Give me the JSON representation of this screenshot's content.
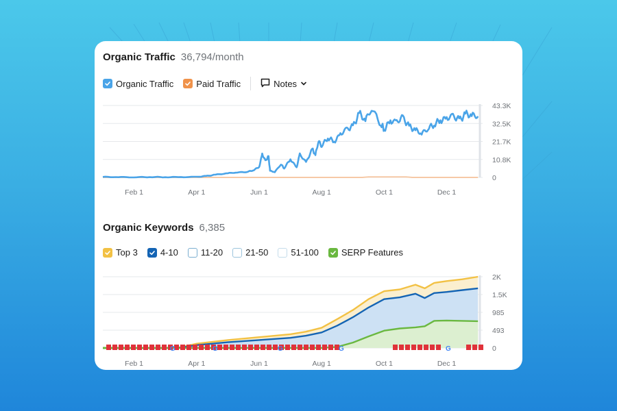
{
  "colors": {
    "organic": "#4aa4e8",
    "paid": "#f0924a",
    "top3": "#f2c144",
    "r4_10": "#1464b4",
    "serp": "#6ab840",
    "flag": "#e0323a",
    "grid": "#e6e8eb",
    "unchecked_border": "#8fb6cf"
  },
  "traffic": {
    "title": "Organic Traffic",
    "value": "36,794/month",
    "legend": [
      {
        "label": "Organic Traffic",
        "checked": true,
        "color": "#4aa4e8"
      },
      {
        "label": "Paid Traffic",
        "checked": true,
        "color": "#f0924a"
      }
    ],
    "notes_label": "Notes",
    "notes_icon": "comment-icon",
    "notes_chevron": "chevron-down-icon"
  },
  "keywords": {
    "title": "Organic Keywords",
    "value": "6,385",
    "legend": [
      {
        "label": "Top 3",
        "checked": true,
        "color": "#f2c144"
      },
      {
        "label": "4-10",
        "checked": true,
        "color": "#1464b4"
      },
      {
        "label": "11-20",
        "checked": false,
        "color": "#7aaed0"
      },
      {
        "label": "21-50",
        "checked": false,
        "color": "#9cc4dd"
      },
      {
        "label": "51-100",
        "checked": false,
        "color": "#c4dcea"
      },
      {
        "label": "SERP Features",
        "checked": true,
        "color": "#6ab840"
      }
    ]
  },
  "chart_data": [
    {
      "type": "line",
      "title": "Organic Traffic",
      "x_ticks": [
        "Feb 1",
        "Apr 1",
        "Jun 1",
        "Aug 1",
        "Oct 1",
        "Dec 1"
      ],
      "y_ticks": [
        "0",
        "10.8K",
        "21.7K",
        "32.5K",
        "43.3K"
      ],
      "ylim": [
        0,
        43300
      ],
      "grid": true,
      "y_axis": "right",
      "x_months": [
        0,
        1,
        2,
        3,
        4,
        5,
        6,
        7,
        8,
        9,
        10,
        11,
        12
      ],
      "series": [
        {
          "name": "Organic Traffic",
          "x": [
            0.0,
            0.5,
            1.0,
            1.5,
            2.0,
            2.5,
            3.0,
            3.3,
            3.6,
            4.0,
            4.3,
            4.6,
            4.8,
            5.0,
            5.1,
            5.2,
            5.3,
            5.35,
            5.5,
            5.7,
            5.8,
            6.0,
            6.2,
            6.3,
            6.5,
            6.7,
            6.8,
            6.9,
            7.0,
            7.2,
            7.4,
            7.6,
            7.8,
            8.0,
            8.2,
            8.4,
            8.6,
            8.9,
            9.0,
            9.2,
            9.4,
            9.6,
            9.8,
            10.0,
            10.2,
            10.4,
            10.6,
            10.8,
            11.0,
            11.2,
            11.4,
            11.6,
            11.8,
            12.0
          ],
          "y": [
            300,
            200,
            100,
            250,
            150,
            200,
            300,
            800,
            1600,
            2500,
            3000,
            3300,
            4200,
            6200,
            14000,
            10000,
            12500,
            4000,
            3200,
            8000,
            5500,
            11000,
            6000,
            14000,
            9000,
            17000,
            13500,
            22000,
            19000,
            24000,
            21500,
            26000,
            29000,
            30500,
            38500,
            34500,
            41500,
            32000,
            29000,
            34000,
            33500,
            36000,
            30500,
            28500,
            26500,
            29500,
            32000,
            34500,
            35500,
            37000,
            34500,
            38000,
            37500,
            36794
          ]
        },
        {
          "name": "Paid Traffic",
          "x": [
            0,
            8.3,
            8.5,
            9.7,
            9.9,
            12
          ],
          "y": [
            0,
            0,
            300,
            300,
            0,
            0
          ]
        }
      ]
    },
    {
      "type": "area",
      "title": "Organic Keywords",
      "x_ticks": [
        "Feb 1",
        "Apr 1",
        "Jun 1",
        "Aug 1",
        "Oct 1",
        "Dec 1"
      ],
      "y_ticks": [
        "0",
        "493",
        "985",
        "1.5K",
        "2K"
      ],
      "ylim": [
        0,
        1970
      ],
      "grid": true,
      "y_axis": "right",
      "series": [
        {
          "name": "Top 3",
          "x": [
            0,
            1,
            2,
            2.5,
            3,
            4,
            5,
            6,
            6.5,
            7,
            7.5,
            8,
            8.5,
            9,
            9.5,
            10,
            10.3,
            10.6,
            11,
            11.5,
            12
          ],
          "y": [
            0,
            0,
            0,
            20,
            120,
            220,
            300,
            380,
            450,
            560,
            800,
            1050,
            1350,
            1570,
            1620,
            1750,
            1650,
            1800,
            1850,
            1900,
            1970
          ]
        },
        {
          "name": "4-10",
          "x": [
            0,
            1,
            2,
            2.5,
            3,
            4,
            5,
            6,
            6.5,
            7,
            7.5,
            8,
            8.5,
            9,
            9.5,
            10,
            10.3,
            10.6,
            11,
            11.5,
            12
          ],
          "y": [
            0,
            0,
            0,
            10,
            80,
            160,
            220,
            280,
            340,
            430,
            620,
            850,
            1120,
            1350,
            1400,
            1500,
            1380,
            1520,
            1550,
            1600,
            1650
          ]
        },
        {
          "name": "SERP Features",
          "x": [
            0,
            5,
            6,
            7,
            7.5,
            8,
            8.5,
            9,
            9.5,
            10,
            10.3,
            10.6,
            11,
            11.5,
            12
          ],
          "y": [
            0,
            0,
            0,
            0,
            30,
            150,
            320,
            480,
            540,
            570,
            600,
            750,
            760,
            750,
            740
          ]
        }
      ],
      "annotation_flags": "red flag and Google update markers along baseline"
    }
  ]
}
